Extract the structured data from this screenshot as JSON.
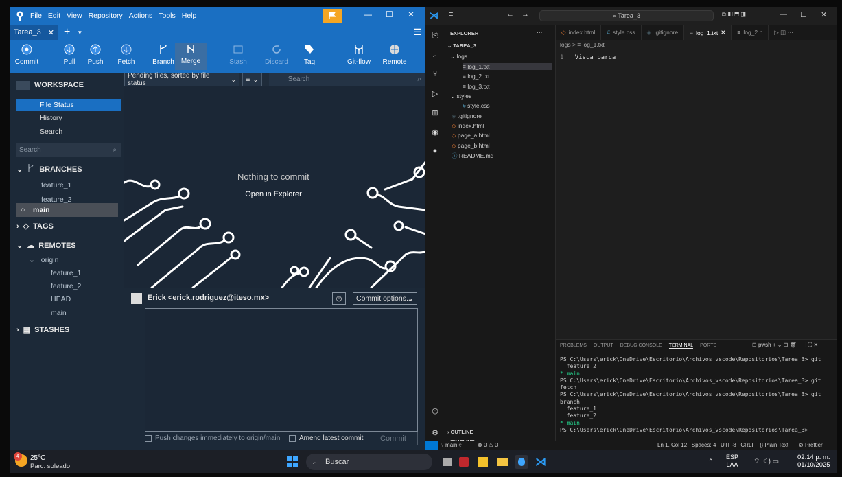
{
  "sourcetree": {
    "menu": [
      "File",
      "Edit",
      "View",
      "Repository",
      "Actions",
      "Tools",
      "Help"
    ],
    "tab": "Tarea_3",
    "toolbar": [
      {
        "label": "Commit",
        "icon": "commit-icon"
      },
      {
        "label": "Pull",
        "icon": "pull-icon"
      },
      {
        "label": "Push",
        "icon": "push-icon"
      },
      {
        "label": "Fetch",
        "icon": "fetch-icon"
      },
      {
        "label": "Branch",
        "icon": "branch-icon"
      },
      {
        "label": "Merge",
        "icon": "merge-icon"
      },
      {
        "label": "Stash",
        "icon": "stash-icon"
      },
      {
        "label": "Discard",
        "icon": "discard-icon"
      },
      {
        "label": "Tag",
        "icon": "tag-icon"
      },
      {
        "label": "Git-flow",
        "icon": "gitflow-icon"
      },
      {
        "label": "Remote",
        "icon": "remote-icon"
      }
    ],
    "sidebar": {
      "workspace": "WORKSPACE",
      "file_status": "File Status",
      "history": "History",
      "search": "Search",
      "search_placeholder": "Search",
      "branches_header": "BRANCHES",
      "branches": [
        "feature_1",
        "feature_2",
        "main"
      ],
      "tags_header": "TAGS",
      "remotes_header": "REMOTES",
      "remote_name": "origin",
      "remote_branches": [
        "feature_1",
        "feature_2",
        "HEAD",
        "main"
      ],
      "stashes_header": "STASHES"
    },
    "filter": {
      "sort": "Pending files, sorted by file status",
      "search_placeholder": "Search"
    },
    "empty": {
      "message": "Nothing to commit",
      "button": "Open in Explorer"
    },
    "commit": {
      "author": "Erick <erick.rodriguez@iteso.mx>",
      "options": "Commit options...",
      "push_checkbox": "Push changes immediately to origin/main",
      "amend_checkbox": "Amend latest commit",
      "commit_button": "Commit"
    }
  },
  "vscode": {
    "search": "Tarea_3",
    "explorer_title": "EXPLORER",
    "root": "TAREA_3",
    "tree": [
      {
        "name": "logs",
        "type": "folder"
      },
      {
        "name": "log_1.txt",
        "type": "txt"
      },
      {
        "name": "log_2.txt",
        "type": "txt"
      },
      {
        "name": "log_3.txt",
        "type": "txt"
      },
      {
        "name": "styles",
        "type": "folder"
      },
      {
        "name": "style.css",
        "type": "css"
      },
      {
        "name": ".gitignore",
        "type": "git"
      },
      {
        "name": "index.html",
        "type": "html"
      },
      {
        "name": "page_a.html",
        "type": "html"
      },
      {
        "name": "page_b.html",
        "type": "html"
      },
      {
        "name": "README.md",
        "type": "info"
      }
    ],
    "outline": "OUTLINE",
    "timeline": "TIMELINE",
    "tabs": [
      "index.html",
      "style.css",
      ".gitignore",
      "log_1.txt",
      "log_2.b"
    ],
    "breadcrumb": "logs > ≡ log_1.txt",
    "line_number": "1",
    "line_text": "Visca barca",
    "panel_tabs": [
      "PROBLEMS",
      "OUTPUT",
      "DEBUG CONSOLE",
      "TERMINAL",
      "PORTS"
    ],
    "panel_shell": "pwsh",
    "terminal": [
      {
        "t": "PS C:\\Users\\erick\\OneDrive\\Escritorio\\Archivos_vscode\\Repositorios\\Tarea_3> git",
        "c": ""
      },
      {
        "t": "  feature_2",
        "c": ""
      },
      {
        "t": "* main",
        "c": "g"
      },
      {
        "t": "PS C:\\Users\\erick\\OneDrive\\Escritorio\\Archivos_vscode\\Repositorios\\Tarea_3> git",
        "c": ""
      },
      {
        "t": "fetch",
        "c": ""
      },
      {
        "t": "PS C:\\Users\\erick\\OneDrive\\Escritorio\\Archivos_vscode\\Repositorios\\Tarea_3> git",
        "c": ""
      },
      {
        "t": "branch",
        "c": ""
      },
      {
        "t": "  feature_1",
        "c": ""
      },
      {
        "t": "  feature_2",
        "c": ""
      },
      {
        "t": "* main",
        "c": "g"
      },
      {
        "t": "PS C:\\Users\\erick\\OneDrive\\Escritorio\\Archivos_vscode\\Repositorios\\Tarea_3> ",
        "c": ""
      }
    ],
    "status_branch": "main",
    "status_errors": "0",
    "status_warnings": "0",
    "status_right": "Ln 1, Col 12   Spaces: 4   UTF-8   CRLF   {} Plain Text",
    "status_prettier": "Prettier"
  },
  "taskbar": {
    "temp": "25°C",
    "weather": "Parc. soleado",
    "badge": "4",
    "search": "Buscar",
    "lang1": "ESP",
    "lang2": "LAA",
    "time": "02:14 p. m.",
    "date": "01/10/2025"
  },
  "colors": {
    "accent": "#1a6fc2",
    "vscode_blue": "#0078d4",
    "flag": "#f5a623"
  }
}
